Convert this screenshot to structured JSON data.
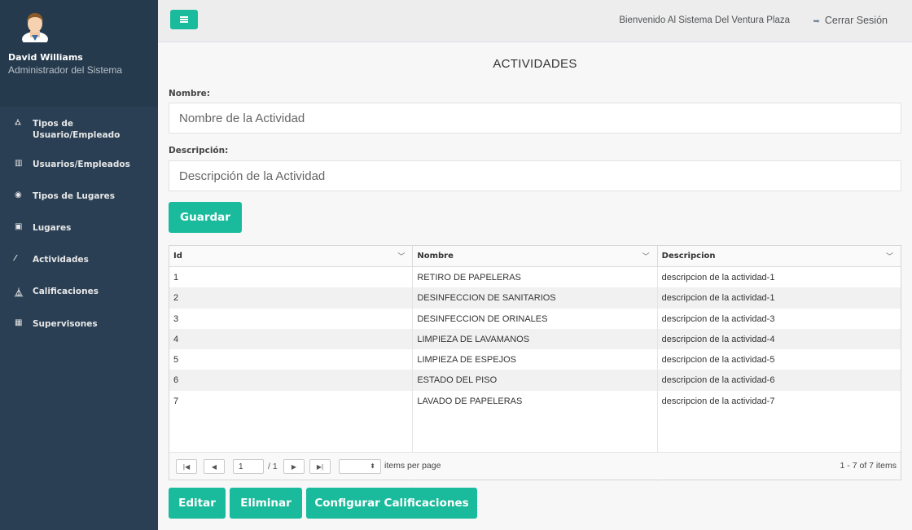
{
  "user": {
    "name": "David Williams",
    "role": "Administrador del Sistema"
  },
  "sidebar": {
    "items": [
      {
        "icon": "sitemap-icon",
        "glyph": "⛼",
        "label": "Tipos de Usuario/Empleado"
      },
      {
        "icon": "bar-chart-icon",
        "glyph": "▥",
        "label": "Usuarios/Empleados"
      },
      {
        "icon": "globe-icon",
        "glyph": "◉",
        "label": "Tipos de Lugares"
      },
      {
        "icon": "image-icon",
        "glyph": "▣",
        "label": "Lugares"
      },
      {
        "icon": "magic-wand-icon",
        "glyph": "⁄",
        "label": "Actividades"
      },
      {
        "icon": "flask-icon",
        "glyph": "⏅",
        "label": "Calificaciones"
      },
      {
        "icon": "table-icon",
        "glyph": "▦",
        "label": "Supervisones"
      }
    ]
  },
  "topbar": {
    "welcome": "Bienvenido Al Sistema Del Ventura Plaza",
    "logout": "Cerrar Sesión",
    "logout_glyph": "➥"
  },
  "main": {
    "title": "ACTIVIDADES",
    "name_label": "Nombre:",
    "name_placeholder": "Nombre de la Actividad",
    "desc_label": "Descripción:",
    "desc_placeholder": "Descripción de la Actividad",
    "save_label": "Guardar"
  },
  "grid": {
    "columns": [
      "Id",
      "Nombre",
      "Descripcion"
    ],
    "rows": [
      [
        "1",
        "RETIRO DE PAPELERAS",
        "descripcion de la actividad-1"
      ],
      [
        "2",
        "DESINFECCION DE SANITARIOS",
        "descripcion de la actividad-1"
      ],
      [
        "3",
        "DESINFECCION DE ORINALES",
        "descripcion de la actividad-3"
      ],
      [
        "4",
        "LIMPIEZA DE LAVAMANOS",
        "descripcion de la actividad-4"
      ],
      [
        "5",
        "LIMPIEZA DE ESPEJOS",
        "descripcion de la actividad-5"
      ],
      [
        "6",
        "ESTADO DEL PISO",
        "descripcion de la actividad-6"
      ],
      [
        "7",
        "LAVADO DE PAPELERAS",
        "descripcion de la actividad-7"
      ]
    ],
    "pager": {
      "page": "1",
      "of_pages": "/ 1",
      "items_per_page": "items per page",
      "count": "1 - 7 of 7 items"
    }
  },
  "actions": {
    "edit": "Editar",
    "delete": "Eliminar",
    "configure": "Configurar Calificaciones"
  },
  "colors": {
    "accent": "#1abb9c",
    "sidebar": "#2a3f54"
  }
}
